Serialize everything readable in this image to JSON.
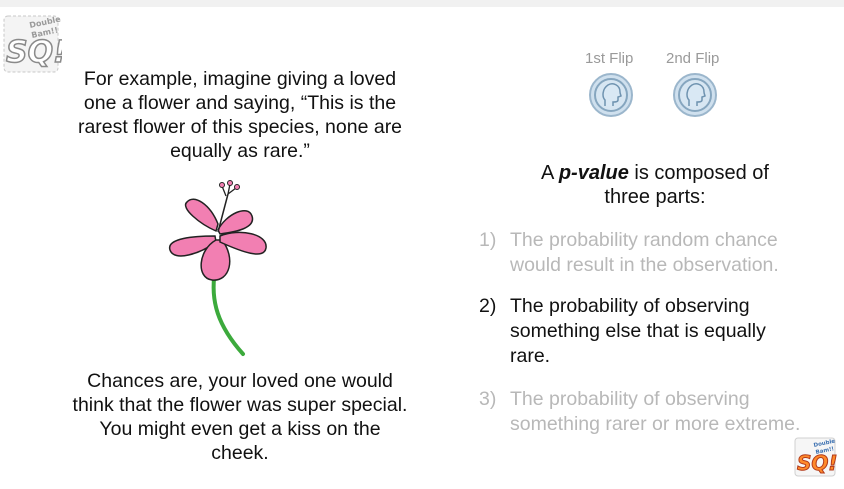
{
  "left": {
    "example_text": [
      "For example, imagine giving a loved",
      "one a flower and saying, “This is the",
      "rarest flower of this species, none are",
      "equally as rare.”"
    ],
    "conclusion_text": [
      "Chances are, your loved one would",
      "think that the flower was super special.",
      "You might even get a kiss on the",
      "cheek."
    ]
  },
  "flips": {
    "first_label": "1st Flip",
    "second_label": "2nd Flip",
    "coin_face": "head-silhouette-icon"
  },
  "pvalue": {
    "intro_prefix": "A ",
    "term": "p-value",
    "intro_suffix": " is composed of",
    "intro_line2": "three parts:"
  },
  "parts": [
    {
      "num": "1)",
      "lines": [
        "The probability random chance",
        "would result in the observation."
      ],
      "state": "dimmed"
    },
    {
      "num": "2)",
      "lines": [
        "The probability of observing",
        "something else that is equally",
        "rare."
      ],
      "state": "highlighted"
    },
    {
      "num": "3)",
      "lines": [
        "The probability of observing",
        "something rarer or more extreme."
      ],
      "state": "dimmed"
    }
  ],
  "colors": {
    "flower_petal": "#f27fb2",
    "flower_stem": "#3caa3c",
    "dimmed_text": "#b8b8b8",
    "coin_fill": "#cfe0ee"
  },
  "logos": {
    "top_left": {
      "big_letters": "SQ!",
      "small_lines": [
        "Double",
        "Bam!!"
      ]
    },
    "bottom_right": {
      "big_letters": "SQ!",
      "small_lines": [
        "Double",
        "Bam!!"
      ]
    }
  }
}
